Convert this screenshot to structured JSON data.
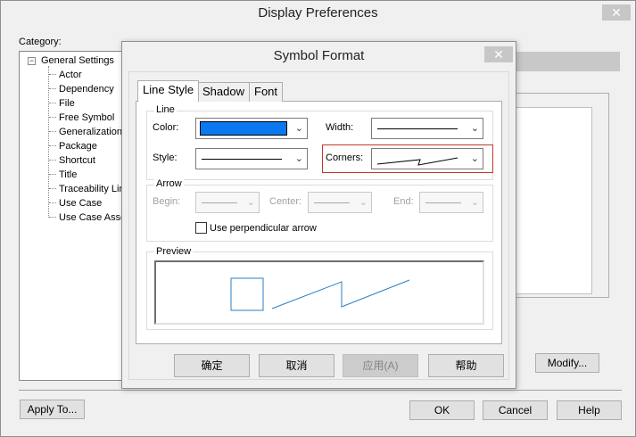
{
  "outer_dialog": {
    "title": "Display Preferences",
    "close_glyph": "✕",
    "category_label": "Category:",
    "tree": {
      "root": "General Settings",
      "root_toggle": "−",
      "children": [
        "Actor",
        "Dependency",
        "File",
        "Free Symbol",
        "Generalization",
        "Package",
        "Shortcut",
        "Title",
        "Traceability Lin",
        "Use Case",
        "Use Case Asso"
      ]
    },
    "modify_label": "Modify...",
    "apply_to_label": "Apply To...",
    "ok_label": "OK",
    "cancel_label": "Cancel",
    "help_label": "Help"
  },
  "inner_dialog": {
    "title": "Symbol Format",
    "close_glyph": "✕",
    "tabs": [
      {
        "label": "Line Style",
        "active": true
      },
      {
        "label": "Shadow",
        "active": false
      },
      {
        "label": "Font",
        "active": false
      }
    ],
    "line_group": {
      "label": "Line",
      "color_label": "Color:",
      "color_value": "#0a78f0",
      "width_label": "Width:",
      "style_label": "Style:",
      "corners_label": "Corners:",
      "dropdown_glyph": "⌄"
    },
    "arrow_group": {
      "label": "Arrow",
      "begin_label": "Begin:",
      "center_label": "Center:",
      "end_label": "End:",
      "perpendicular_label": "Use perpendicular arrow",
      "perpendicular_checked": false
    },
    "preview_group": {
      "label": "Preview",
      "stroke_color": "#2a7fc0"
    },
    "buttons": {
      "ok": "确定",
      "cancel": "取消",
      "apply": "应用(A)",
      "help": "帮助"
    }
  }
}
